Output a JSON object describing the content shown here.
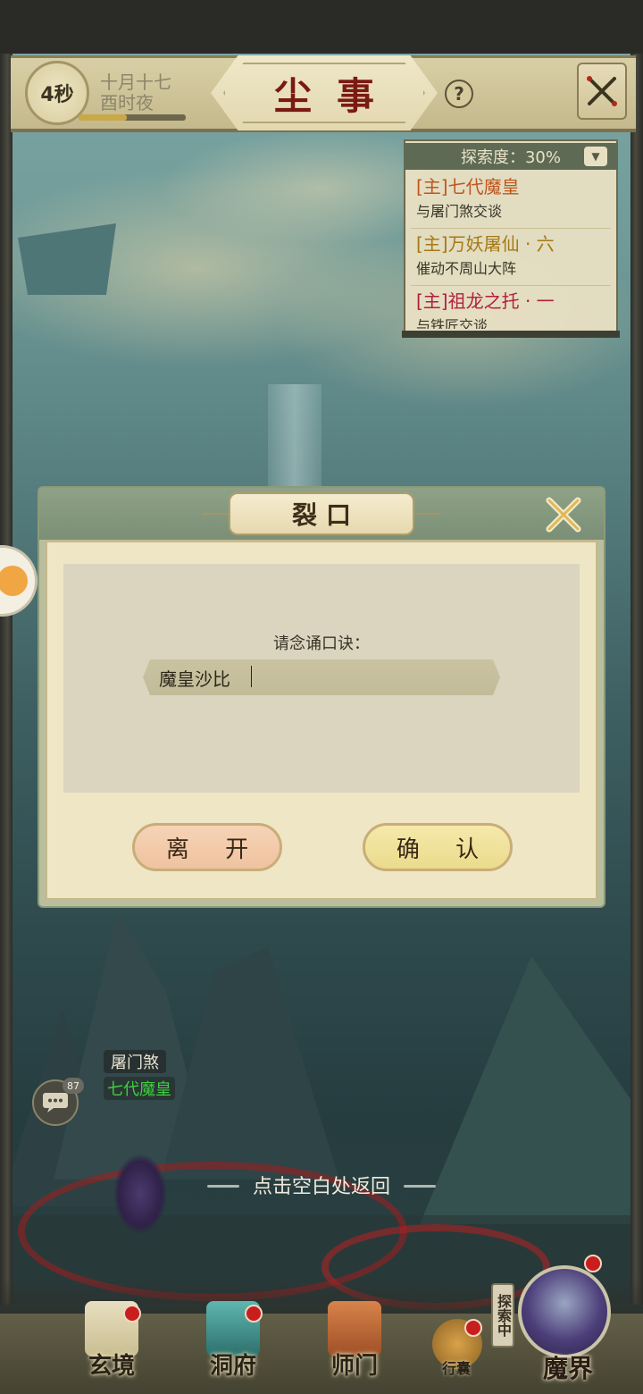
{
  "header": {
    "timer": "4秒",
    "date_line1": "十月十七",
    "date_line2": "酉时夜",
    "time_progress": 0.45,
    "title": "尘事",
    "help": "?"
  },
  "quest_panel": {
    "explore_label": "探索度：30%",
    "quests": [
      {
        "title": "[主]七代魔皇",
        "desc": "与屠门煞交谈",
        "color": "#c0561e"
      },
      {
        "title": "[主]万妖屠仙 · 六",
        "desc": "催动不周山大阵",
        "color": "#a57a14"
      },
      {
        "title": "[主]祖龙之托 · 一",
        "desc": "与铁匠交谈",
        "color": "#b0203e"
      }
    ]
  },
  "dialog": {
    "title": "裂口",
    "prompt": "请念诵口诀：",
    "input_value": "魔皇沙比",
    "leave_label": "离 开",
    "confirm_label": "确 认"
  },
  "world": {
    "npc_name": "屠门煞",
    "player_name": "七代魔皇",
    "chat_count": "87",
    "return_hint": "点击空白处返回"
  },
  "bottom_nav": {
    "items": [
      {
        "label": "玄境",
        "icon": "scroll-icon"
      },
      {
        "label": "洞府",
        "icon": "pavilion-icon"
      },
      {
        "label": "师门",
        "icon": "banner-icon"
      }
    ],
    "bag_label": "行囊",
    "explore_tag": "探索中",
    "realm_label": "魔界"
  }
}
